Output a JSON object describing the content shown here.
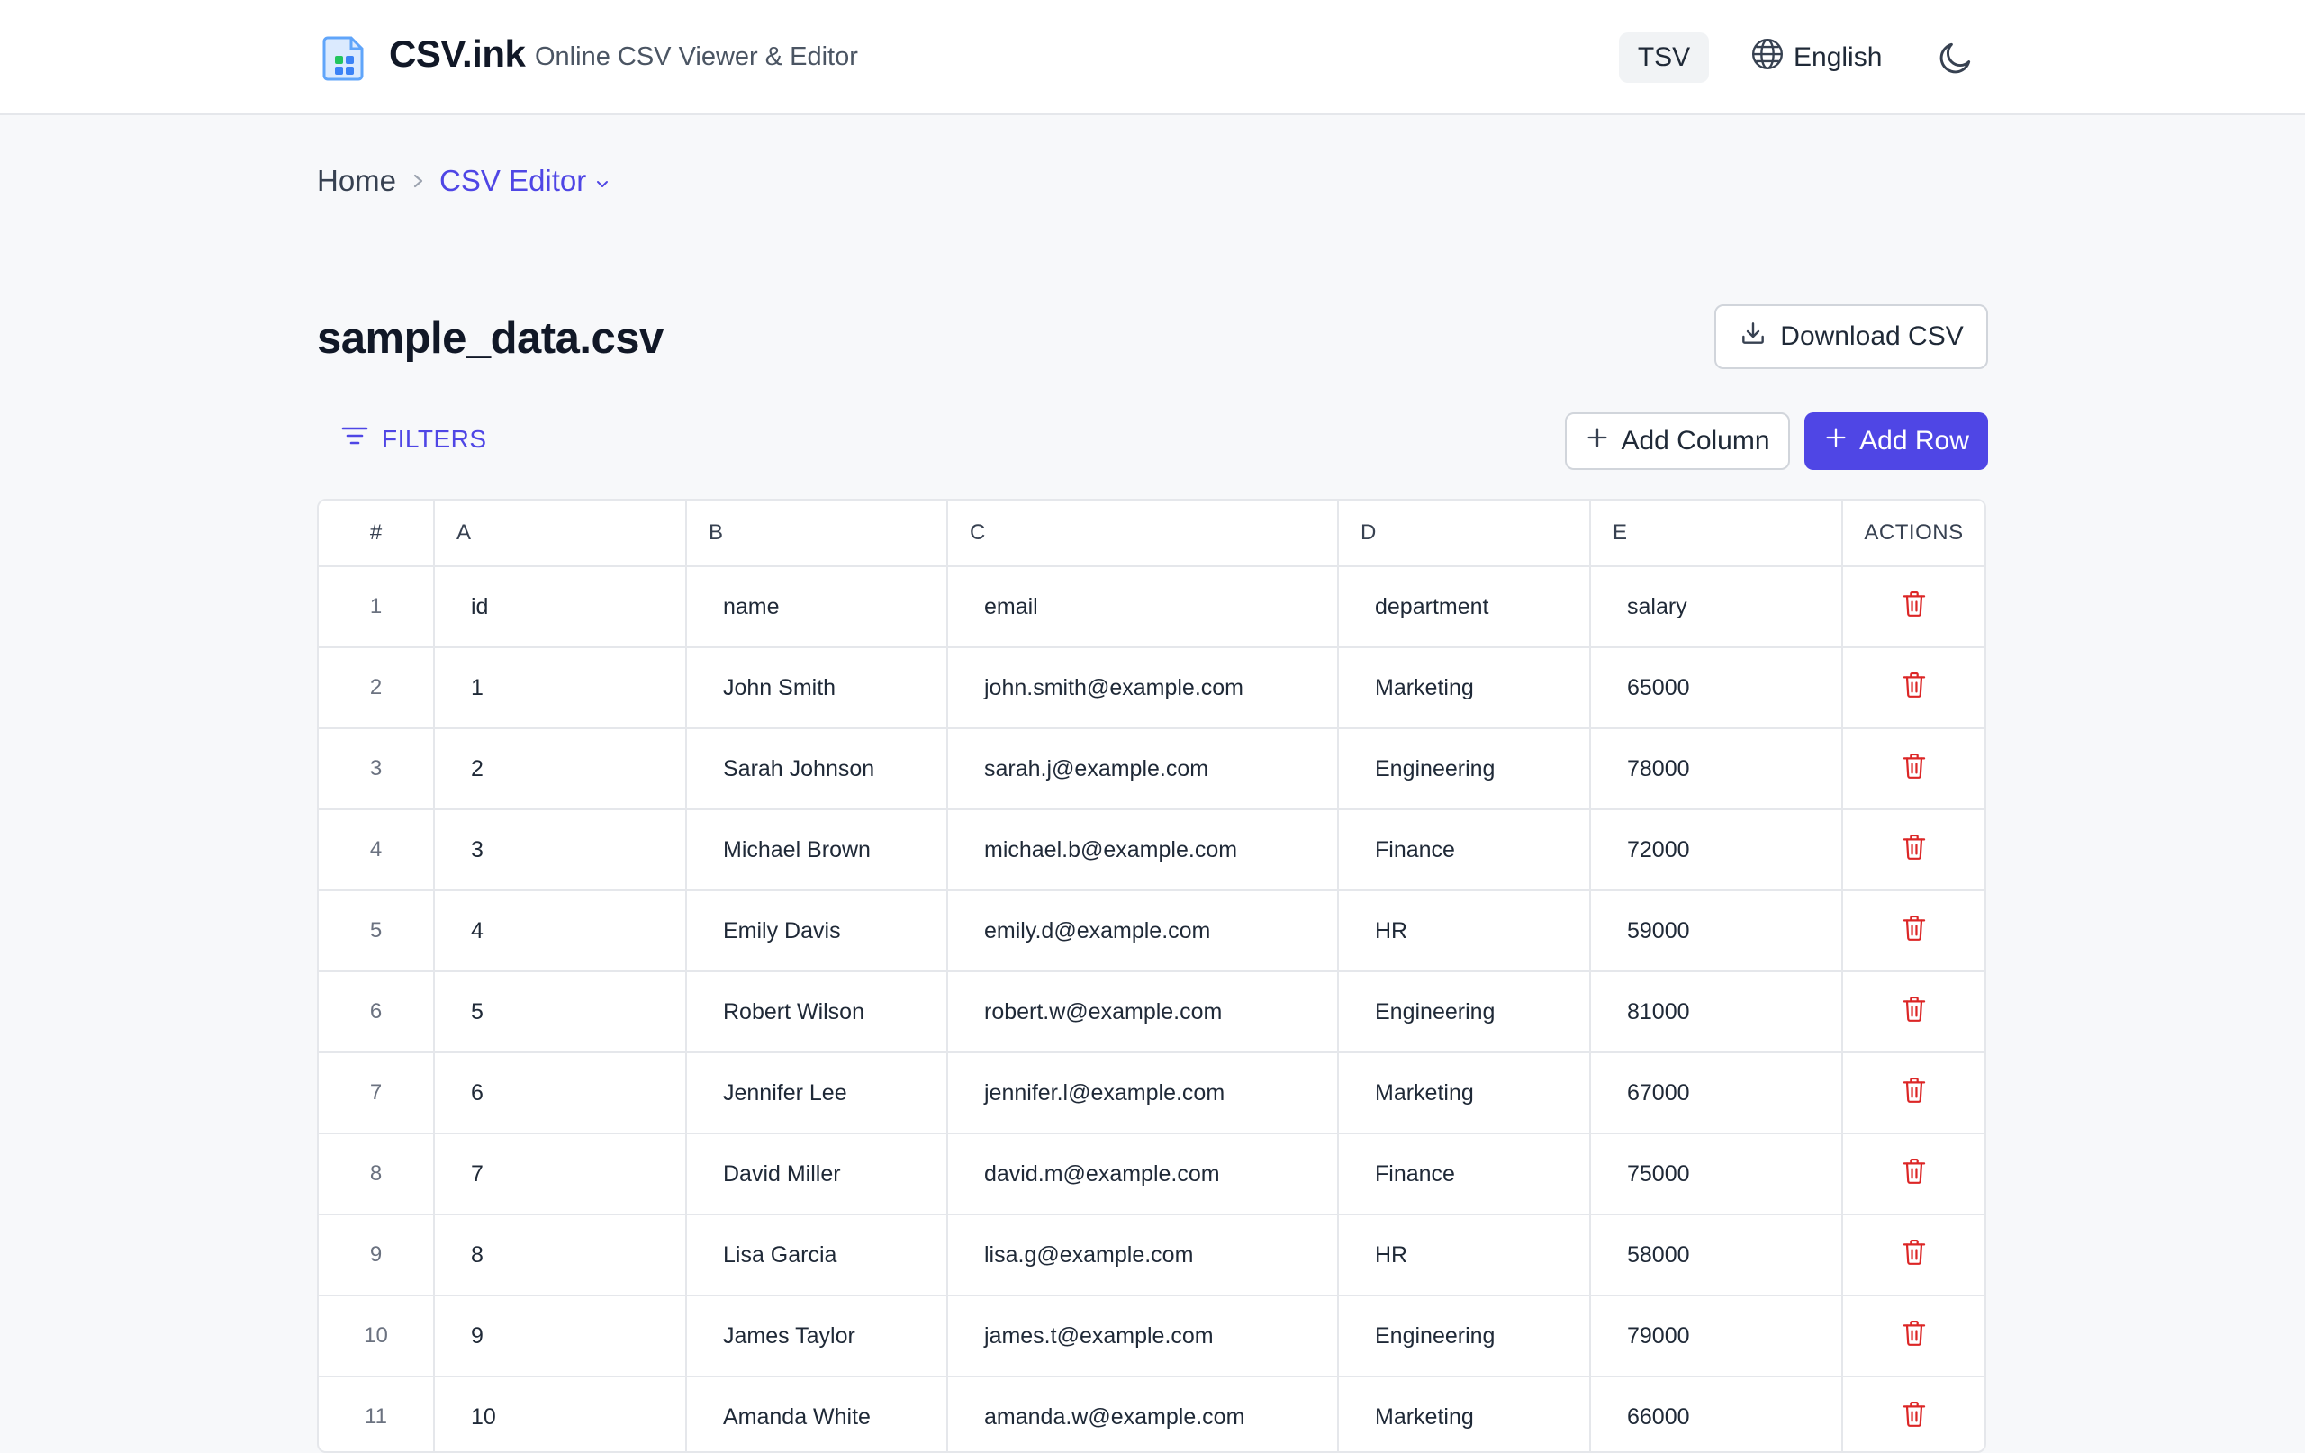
{
  "header": {
    "brand": "CSV.ink",
    "tagline": "Online CSV Viewer & Editor",
    "tsv_label": "TSV",
    "language_label": "English",
    "accent": "#4f46e5"
  },
  "breadcrumb": {
    "home": "Home",
    "current": "CSV Editor"
  },
  "file": {
    "title": "sample_data.csv",
    "download_label": "Download CSV"
  },
  "toolbar": {
    "filters_label": "FILTERS",
    "add_column_label": "Add Column",
    "add_row_label": "Add Row"
  },
  "table": {
    "columns": [
      "#",
      "A",
      "B",
      "C",
      "D",
      "E",
      "ACTIONS"
    ],
    "rows": [
      [
        "1",
        "id",
        "name",
        "email",
        "department",
        "salary"
      ],
      [
        "2",
        "1",
        "John Smith",
        "john.smith@example.com",
        "Marketing",
        "65000"
      ],
      [
        "3",
        "2",
        "Sarah Johnson",
        "sarah.j@example.com",
        "Engineering",
        "78000"
      ],
      [
        "4",
        "3",
        "Michael Brown",
        "michael.b@example.com",
        "Finance",
        "72000"
      ],
      [
        "5",
        "4",
        "Emily Davis",
        "emily.d@example.com",
        "HR",
        "59000"
      ],
      [
        "6",
        "5",
        "Robert Wilson",
        "robert.w@example.com",
        "Engineering",
        "81000"
      ],
      [
        "7",
        "6",
        "Jennifer Lee",
        "jennifer.l@example.com",
        "Marketing",
        "67000"
      ],
      [
        "8",
        "7",
        "David Miller",
        "david.m@example.com",
        "Finance",
        "75000"
      ],
      [
        "9",
        "8",
        "Lisa Garcia",
        "lisa.g@example.com",
        "HR",
        "58000"
      ],
      [
        "10",
        "9",
        "James Taylor",
        "james.t@example.com",
        "Engineering",
        "79000"
      ],
      [
        "11",
        "10",
        "Amanda White",
        "amanda.w@example.com",
        "Marketing",
        "66000"
      ]
    ]
  }
}
